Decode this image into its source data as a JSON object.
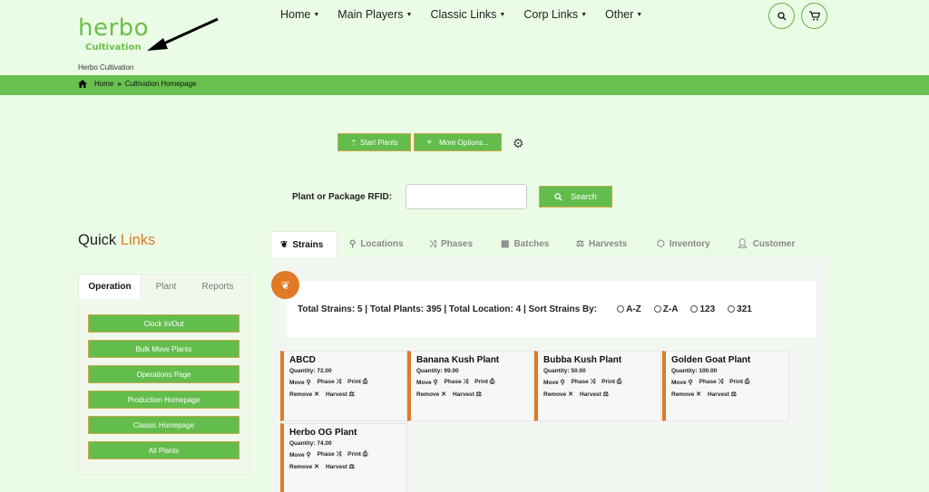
{
  "header": {
    "logo_main": "herbo",
    "logo_sub": "Cultivation",
    "site_name": "Herbo Cultivation",
    "nav": [
      {
        "label": "Home"
      },
      {
        "label": "Main Players"
      },
      {
        "label": "Classic Links"
      },
      {
        "label": "Corp Links"
      },
      {
        "label": "Other"
      }
    ],
    "search_icon": "search-icon",
    "cart_icon": "cart-icon"
  },
  "breadcrumb": {
    "home": "Home",
    "current": "Cultivation Homepage"
  },
  "actions": {
    "start_plants": "Start Plants",
    "more_options": "More Options..."
  },
  "rfid": {
    "label": "Plant or Package RFID:",
    "value": "",
    "search_label": "Search"
  },
  "quick_links": {
    "title_plain": "Quick",
    "title_accent": "Links",
    "tabs": [
      "Operation",
      "Plant",
      "Reports"
    ],
    "active_tab": "Operation",
    "buttons": [
      "Clock In/Out",
      "Bulk Move Plants",
      "Operations Page",
      "Production Homepage",
      "Classic Homepage",
      "All Plants"
    ]
  },
  "main_tabs": [
    {
      "label": "Strains",
      "icon": "leaf-icon",
      "active": true
    },
    {
      "label": "Locations",
      "icon": "map-marker-icon"
    },
    {
      "label": "Phases",
      "icon": "shuffle-icon"
    },
    {
      "label": "Batches",
      "icon": "grid-icon"
    },
    {
      "label": "Harvests",
      "icon": "scale-icon"
    },
    {
      "label": "Inventory",
      "icon": "cubes-icon"
    },
    {
      "label": "Customer",
      "icon": "user-icon"
    }
  ],
  "summary": {
    "text": "Total Strains: 5 | Total Plants: 395 | Total Location: 4 | Sort Strains By:",
    "sort_options": [
      "A-Z",
      "Z-A",
      "123",
      "321"
    ]
  },
  "card_actions": {
    "move": "Move",
    "phase": "Phase",
    "print": "Print",
    "remove": "Remove",
    "harvest": "Harvest"
  },
  "strains": [
    {
      "name": "ABCD",
      "quantity": "Quantity: 72.00"
    },
    {
      "name": "Banana Kush Plant",
      "quantity": "Quantity: 99.00"
    },
    {
      "name": "Bubba Kush Plant",
      "quantity": "Quantity: 50.00"
    },
    {
      "name": "Golden Goat Plant",
      "quantity": "Quantity: 100.00"
    },
    {
      "name": "Herbo OG Plant",
      "quantity": "Quantity: 74.00"
    }
  ],
  "colors": {
    "brand_green": "#62bd4c",
    "accent_orange": "#e07a25",
    "page_bg": "#ebfce6"
  }
}
